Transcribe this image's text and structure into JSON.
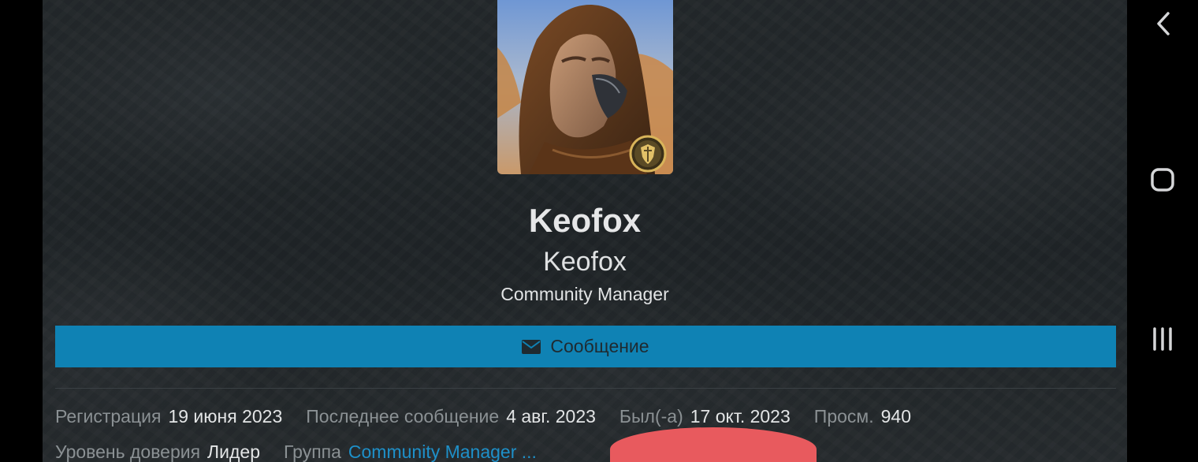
{
  "profile": {
    "username": "Keofox",
    "display_name": "Keofox",
    "title": "Community Manager",
    "avatar_icon": "avatar-image",
    "badge_icon": "shield-badge-icon"
  },
  "actions": {
    "message_label": "Сообщение",
    "message_icon": "envelope-icon",
    "button_color": "#0f82b4"
  },
  "stats": {
    "registration_label": "Регистрация",
    "registration_value": "19 июня 2023",
    "last_post_label": "Последнее сообщение",
    "last_post_value": "4 авг. 2023",
    "last_seen_label": "Был(-а)",
    "last_seen_value": "17 окт. 2023",
    "views_label": "Просм.",
    "views_value": "940",
    "trust_label": "Уровень доверия",
    "trust_value": "Лидер",
    "group_label": "Группа",
    "group_value": "Community Manager ..."
  },
  "system_nav": {
    "back_icon": "back-chevron-icon",
    "home_icon": "home-square-icon",
    "recents_icon": "recents-lines-icon"
  },
  "colors": {
    "background": "#23282b",
    "accent": "#0f82b4",
    "link": "#1e90c9",
    "redaction": "#e85a5e"
  }
}
